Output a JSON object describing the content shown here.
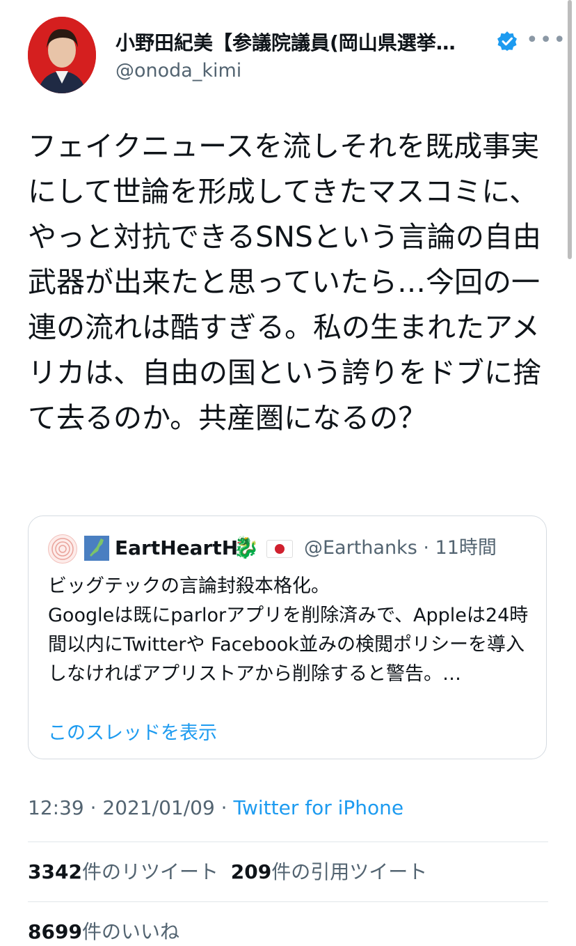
{
  "author": {
    "display_name": "小野田紀美【参議院議員(岡山県選挙…",
    "handle": "@onoda_kimi",
    "more_icon": "more-horizontal-icon",
    "verified_color": "#1d9bf0"
  },
  "tweet": {
    "text": "フェイクニュースを流しそれを既成事実にして世論を形成してきたマスコミに、やっと対抗できるSNSという言論の自由武器が出来たと思っていたら…今回の一連の流れは酷すぎる。私の生まれたアメリカは、自由の国という誇りをドブに捨て去るのか。共産圏になるの？"
  },
  "quoted": {
    "name": "EartHeartH",
    "dragon_emoji": "🐉",
    "handle_time": "@Earthanks · 11時間",
    "body": "ビッグテックの言論封殺本格化。\nGoogleは既にparlorアプリを削除済みで、Appleは24時間以内にTwitterや Facebook並みの検閲ポリシーを導入しなければアプリストアから削除すると警告。…",
    "show_thread": "このスレッドを表示"
  },
  "meta": {
    "time_date": "12:39 · 2021/01/09 · ",
    "source": "Twitter for iPhone"
  },
  "stats": {
    "retweets_count": "3342",
    "retweets_label": "件のリツイート",
    "quotes_count": "209",
    "quotes_label": "件の引用ツイート",
    "likes_count": "8699",
    "likes_label": "件のいいね"
  }
}
